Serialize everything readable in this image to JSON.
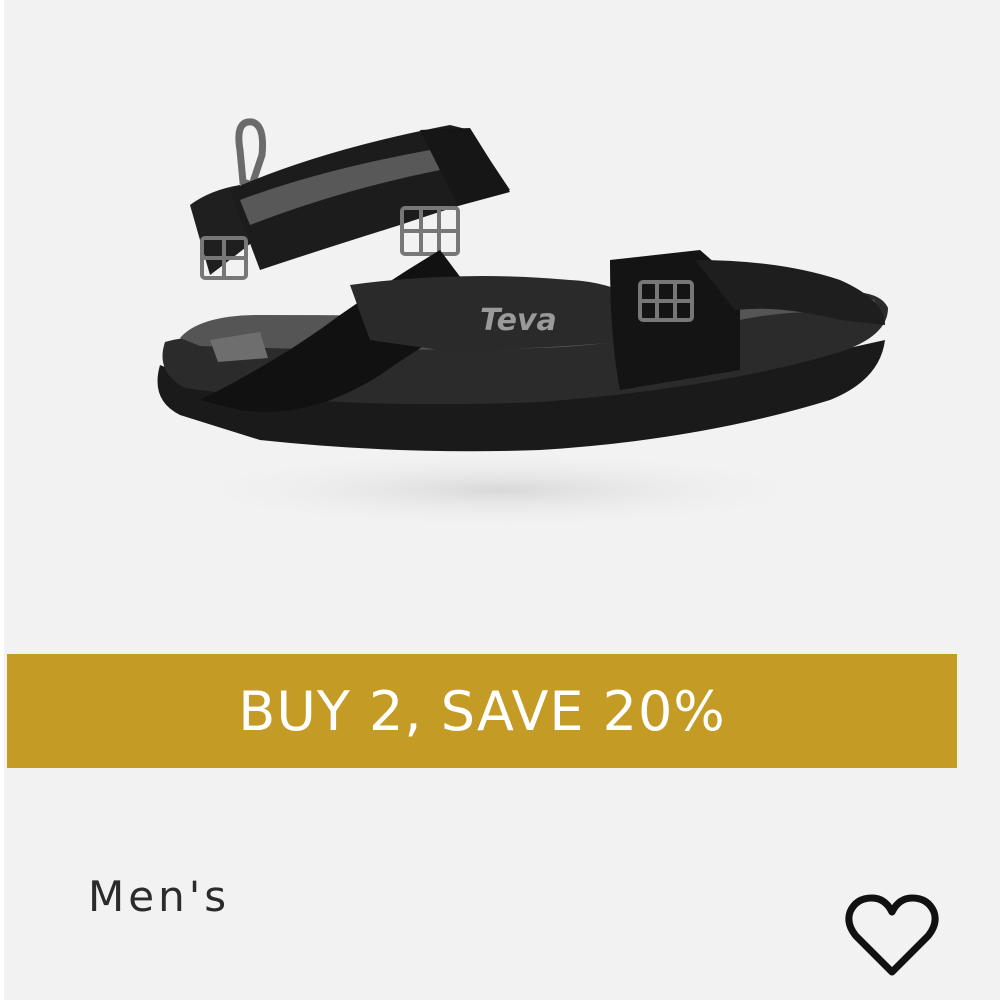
{
  "product": {
    "image_alt": "Teva black sport sandal",
    "brand_logo_text": "Teva",
    "gender": "Men's"
  },
  "promo": {
    "label": "BUY 2, SAVE 20%",
    "color": "#c49b24",
    "text_color": "#ffffff"
  },
  "wishlist": {
    "icon": "heart-outline-icon",
    "aria_label": "Add to wishlist"
  }
}
